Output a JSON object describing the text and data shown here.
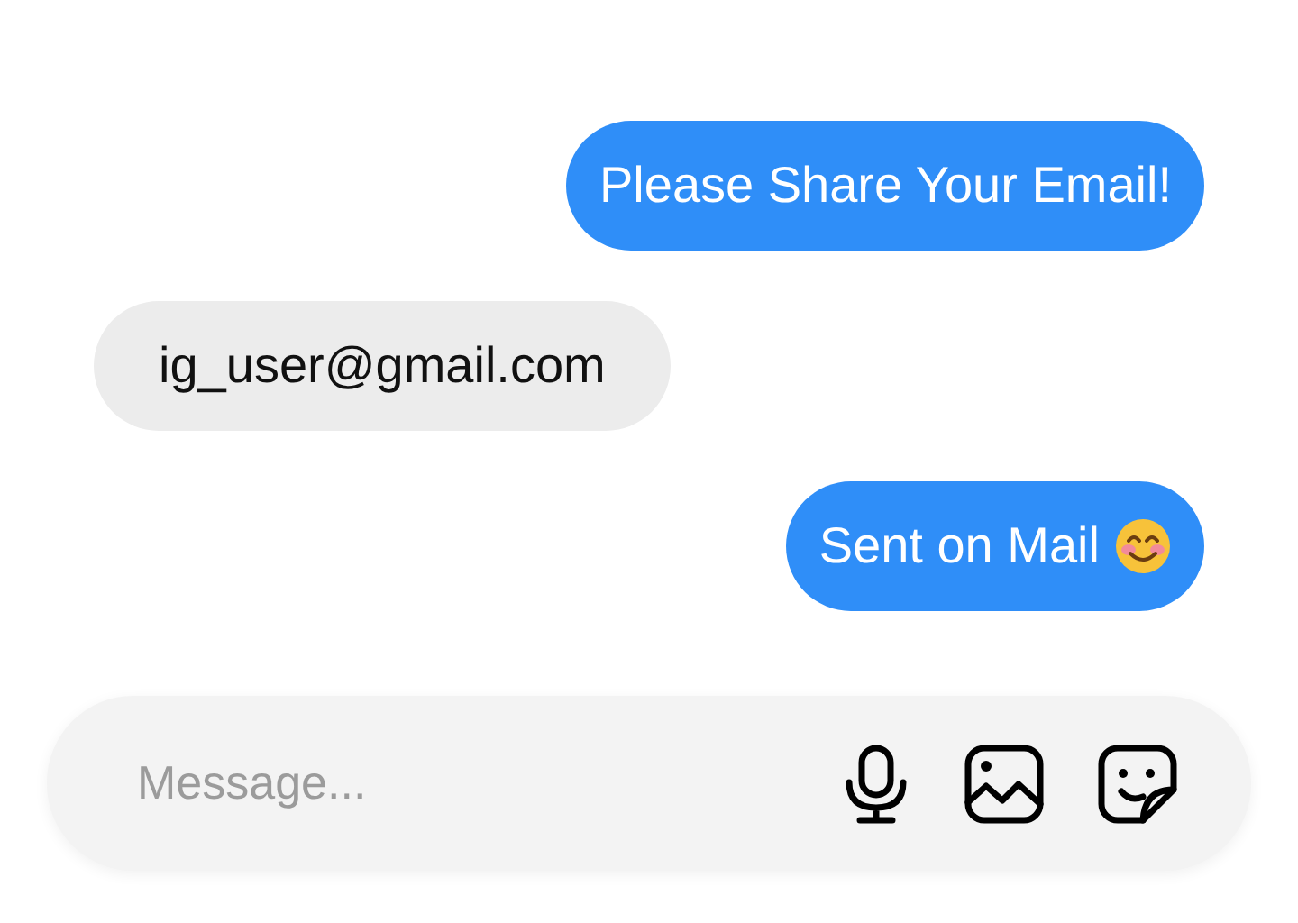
{
  "messages": [
    {
      "kind": "sent",
      "text": "Please Share Your Email!"
    },
    {
      "kind": "received",
      "text": "ig_user@gmail.com"
    },
    {
      "kind": "sent",
      "text": "Sent on Mail",
      "emoji": true
    }
  ],
  "composer": {
    "placeholder": "Message..."
  }
}
